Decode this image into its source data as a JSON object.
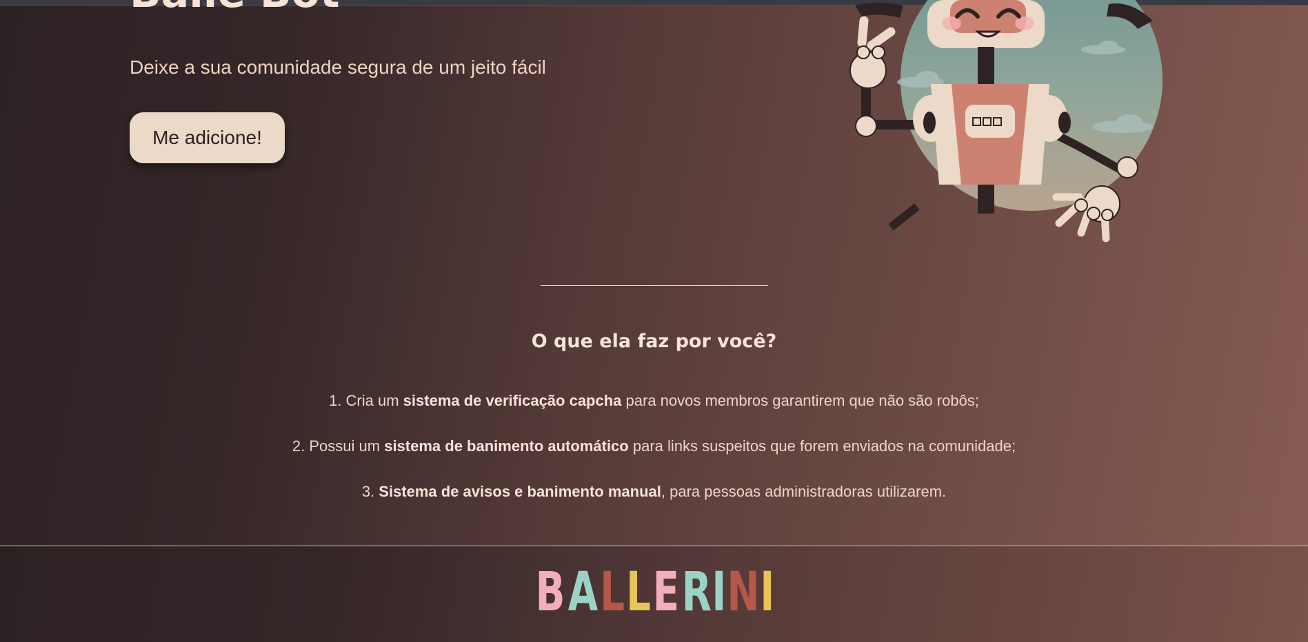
{
  "hero": {
    "title": "Ballé Bot",
    "subtitle": "Deixe a sua comunidade segura de um jeito fácil",
    "cta_label": "Me adicione!"
  },
  "features": {
    "title": "O que ela faz por você?",
    "items": [
      {
        "prefix": "1. Cria um ",
        "bold": "sistema de verificação capcha",
        "suffix": " para novos membros garantirem que não são robôs;"
      },
      {
        "prefix": "2. Possui um ",
        "bold": "sistema de banimento automático",
        "suffix": " para links suspeitos que forem enviados na comunidade;"
      },
      {
        "prefix": "3. ",
        "bold": "Sistema de avisos e banimento manual",
        "suffix": ", para pessoas administradoras utilizarem."
      }
    ]
  },
  "footer": {
    "logo_letters": [
      {
        "char": "B",
        "color": "#f2aebc"
      },
      {
        "char": "A",
        "color": "#9ad3c6"
      },
      {
        "char": "L",
        "color": "#b5584a"
      },
      {
        "char": "L",
        "color": "#e8c45a"
      },
      {
        "char": "E",
        "color": "#f2aebc"
      },
      {
        "char": "R",
        "color": "#9ad3c6"
      },
      {
        "char": "I",
        "color": "#9ad3c6"
      },
      {
        "char": "N",
        "color": "#b5584a"
      },
      {
        "char": "I",
        "color": "#e8c45a"
      }
    ]
  },
  "colors": {
    "accent_button": "#ecd9c8",
    "text_light": "#f1dfd0"
  }
}
